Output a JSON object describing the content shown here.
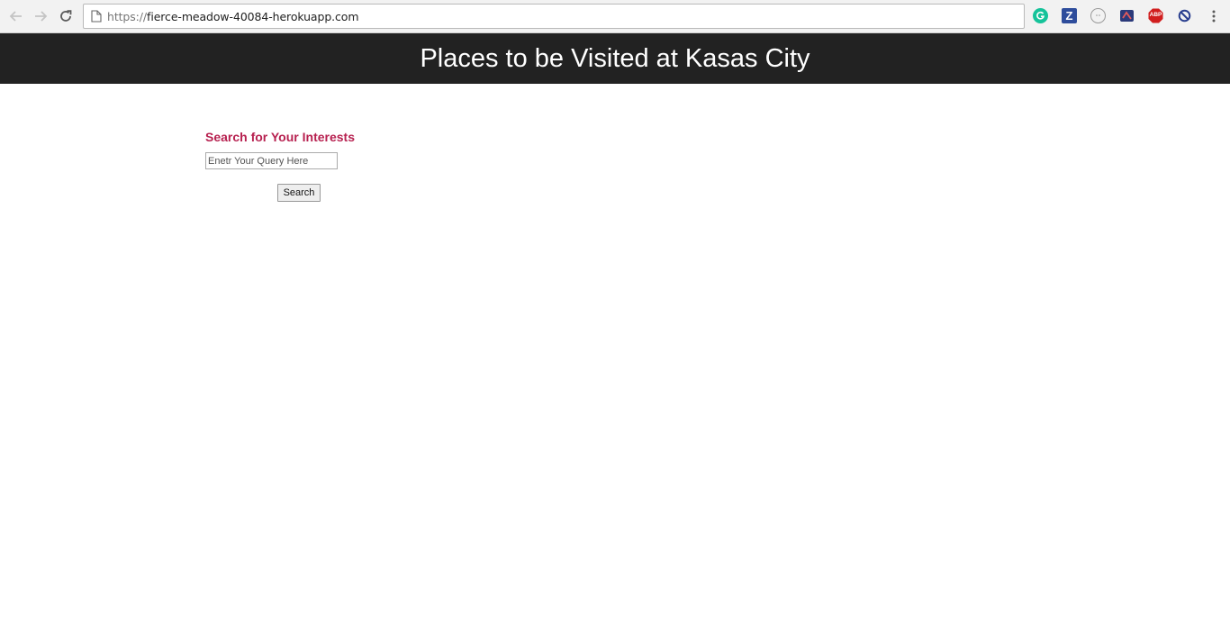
{
  "browser": {
    "url_scheme": "https://",
    "url_host": "fierce-meadow-40084-herokuapp.com",
    "icons": {
      "back": "arrow-left-icon",
      "forward": "arrow-right-icon",
      "reload": "reload-icon",
      "page": "page-icon",
      "extensions": [
        "grammarly-icon",
        "zotero-icon",
        "ghostery-icon",
        "pocket-icon",
        "adblock-plus-icon",
        "block-icon"
      ],
      "menu": "more-vertical-icon"
    },
    "extension_labels": {
      "zotero": "Z",
      "abp": "ABP"
    }
  },
  "header": {
    "title": "Places to be Visited at Kasas City",
    "background": "#222222"
  },
  "search": {
    "heading": "Search for Your Interests",
    "input_placeholder": "Enetr Your Query Here",
    "input_value": "",
    "button_label": "Search",
    "accent_color": "#b72150"
  }
}
